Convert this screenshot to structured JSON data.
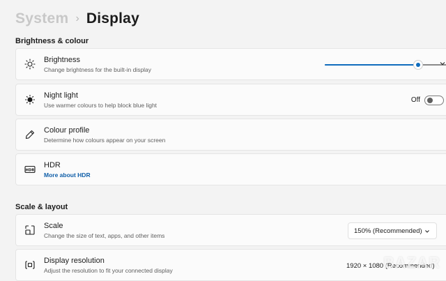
{
  "breadcrumb": {
    "parent": "System",
    "separator": "›",
    "current": "Display"
  },
  "sections": {
    "brightness_colour": "Brightness & colour",
    "scale_layout": "Scale & layout"
  },
  "brightness": {
    "title": "Brightness",
    "description": "Change brightness for the built-in display",
    "value_fraction": 0.73
  },
  "night_light": {
    "title": "Night light",
    "description": "Use warmer colours to help block blue light",
    "state": "Off"
  },
  "colour_profile": {
    "title": "Colour profile",
    "description": "Determine how colours appear on your screen"
  },
  "hdr": {
    "title": "HDR",
    "link": "More about HDR"
  },
  "scale": {
    "title": "Scale",
    "description": "Change the size of text, apps, and other items",
    "selected": "150% (Recommended)"
  },
  "display_resolution": {
    "title": "Display resolution",
    "description": "Adjust the resolution to fit your connected display",
    "selected": "1920 × 1080 (Recommended)"
  },
  "watermark": "BAZAR",
  "colors": {
    "accent": "#0f6cbd",
    "background": "#f3f3f3",
    "card": "#fbfbfb"
  },
  "icons": {
    "brightness": "sun-icon",
    "night_light": "sun-dim-icon",
    "colour_profile": "pen-icon",
    "hdr": "hdr-icon",
    "scale": "scale-icon",
    "display_resolution": "resolution-icon",
    "chevron": "chevron-right-icon"
  }
}
